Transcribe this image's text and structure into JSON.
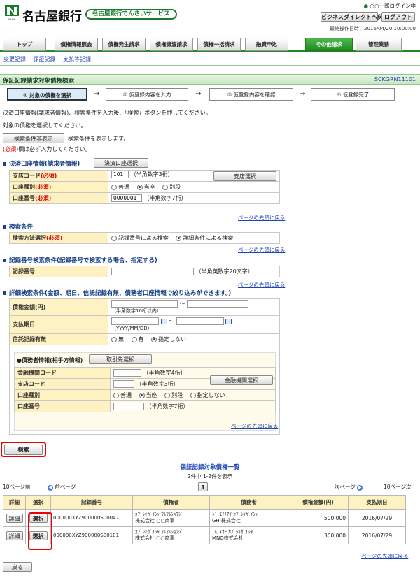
{
  "header": {
    "bank_name": "名古屋銀行",
    "service_badge": "名古屋銀行でんさいサービス",
    "user_line": "○○一郎ログイン中",
    "back_to_biz": "ビジネスダイレクトへ戻る",
    "logout": "ログアウト",
    "last_op": "最終操作日時：2016/04/20 10:00:00"
  },
  "tabs": [
    "トップ",
    "債権情報照会",
    "債権発生請求",
    "債権譲渡請求",
    "債権一括請求",
    "融資申込",
    "その他請求",
    "管理業務"
  ],
  "subnav": [
    "変更記録",
    "保証記録",
    "支払等記録"
  ],
  "page": {
    "title": "保証記録請求対象債権検索",
    "code": "SCKGRN11101",
    "steps": [
      "① 対象の債権を選択",
      "② 仮登録内容を入力",
      "③ 仮登録内容を確認",
      "④ 仮登録完了"
    ],
    "arrow": "→",
    "instr1": "決済口座情報(請求者情報)、検索条件を入力後、「検索」ボタンを押してください。",
    "instr2": "対象の債権を選択してください。",
    "toggle_btn": "検索条件非表示",
    "toggle_note": "検索条件を表示します。",
    "req_mark": "(必須)",
    "req_note": "欄は必ず入力してください。",
    "page_top": "ページの先頭に戻る"
  },
  "account": {
    "title": "決済口座情報(請求者情報)",
    "select_btn": "決済口座選択",
    "branch_label": "支店コード",
    "branch_value": "101",
    "branch_hint": "（半角数字3桁）",
    "branch_btn": "支店選択",
    "type_label": "口座種別",
    "types": [
      "普通",
      "当座",
      "別段"
    ],
    "number_label": "口座番号",
    "number_value": "0000001",
    "number_hint": "（半角数字7桁）"
  },
  "search_cond": {
    "title": "検索条件",
    "method_label": "検索方法選択",
    "methods": [
      "記録番号による検索",
      "詳細条件による検索"
    ]
  },
  "record_search": {
    "title": "記録番号検索条件(記録番号で検索する場合、指定する)",
    "label": "記録番号",
    "hint": "（半角英数字20文字）"
  },
  "detail_search": {
    "title": "詳細検索条件(金額、期日、信託記録有無、債務者口座情報で絞り込みができます。)",
    "amount_label": "債権金額(円)",
    "amount_hint": "（半角数字10桁以内）",
    "tilde": "～",
    "date_label": "支払期日",
    "date_hint": "（YYYY/MM/DD）",
    "trust_label": "信託記録有無",
    "trust_opts": [
      "無",
      "有",
      "指定しない"
    ],
    "debtor_title": "●債務者情報(相手方情報)",
    "partner_btn": "取引先選択",
    "bank_code_label": "金融機関コード",
    "bank_code_hint": "（半角数字4桁）",
    "bank_btn": "金融機関選択",
    "branch_code_label": "支店コード",
    "branch_code_hint": "（半角数字3桁）",
    "acct_type_label": "口座種別",
    "acct_types": [
      "普通",
      "当座",
      "別段",
      "指定しない"
    ],
    "acct_no_label": "口座番号",
    "acct_no_hint": "（半角数字7桁）"
  },
  "search_btn": "検索",
  "results": {
    "title": "保証記録対象債権一覧",
    "count": "2件中 1-2件を表示",
    "prev10": "10ページ前",
    "prev": "前ページ",
    "page": "1",
    "next": "次ページ",
    "next10": "10ページ次",
    "headers": [
      "詳細",
      "選択",
      "記録番号",
      "債権者",
      "債務者",
      "債権金額(円)",
      "支払期日"
    ],
    "rows": [
      {
        "detail": "詳細",
        "select": "選択",
        "record": "000000XYZ900000S00047",
        "creditor1": "ｶﾌﾞｼｷｶﾞｲｼｬ ﾏﾙﾏﾙｼｮｳｼﾞ",
        "creditor2": "株式会社 ○○商事",
        "debtor1": "ｼﾞｰｴｲﾁｱｲ ｶﾌﾞｼｷｶﾞｲｼｬ",
        "debtor2": "GHI株式会社",
        "amount": "500,000",
        "due": "2016/07/29"
      },
      {
        "detail": "詳細",
        "select": "選択",
        "record": "000000XYZ900000S00101",
        "creditor1": "ｶﾌﾞｼｷｶﾞｲｼｬ ﾏﾙﾏﾙｼｮｳｼﾞ",
        "creditor2": "株式会社 ○○商事",
        "debtor1": "ｴﾑｴﾇｵｰ ｶﾌﾞｼｷｶﾞｲｼｬ",
        "debtor2": "MNO株式会社",
        "amount": "300,000",
        "due": "2016/07/29"
      }
    ]
  },
  "back_btn": "戻る"
}
